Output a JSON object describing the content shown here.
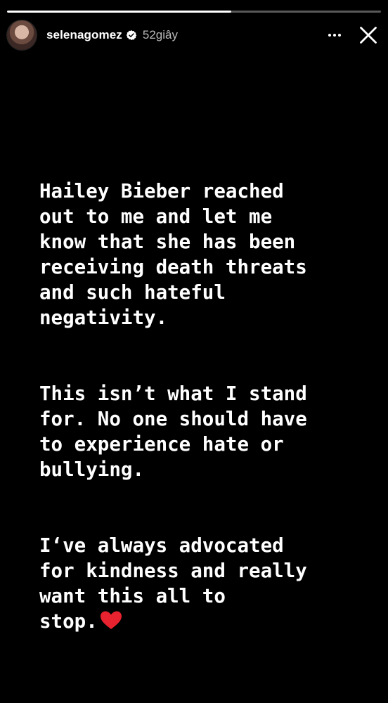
{
  "progress": {
    "fraction": 0.6
  },
  "header": {
    "username": "selenagomez",
    "timestamp": "52giây",
    "verified": true,
    "more_icon": "more-horizontal-icon",
    "close_icon": "close-icon"
  },
  "story": {
    "paragraphs": [
      "Hailey Bieber reached\nout to me and let me\nknow that she has been\nreceiving death threats\nand such hateful\nnegativity.",
      "This isn’t what I stand\nfor. No one should have\nto experience hate or\nbullying.",
      "I‘ve always advocated\nfor kindness and really\nwant this all to\nstop."
    ],
    "heart_icon": "red-heart-icon",
    "heart_color": "#e8222f"
  },
  "colors": {
    "background": "#000000",
    "text": "#ffffff",
    "verified_badge": "#ffffff"
  }
}
